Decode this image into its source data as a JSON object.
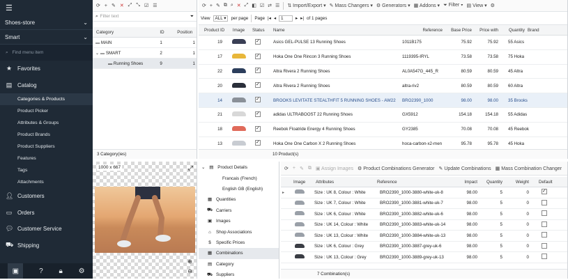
{
  "sidebar": {
    "store": "Shoes-store",
    "mode": "Smart",
    "search_placeholder": "Find menu item",
    "items": [
      {
        "label": "Favorites",
        "icon": "star-icon"
      },
      {
        "label": "Catalog",
        "icon": "catalog-icon"
      }
    ],
    "catalog_sub": [
      "Categories & Products",
      "Product Picker",
      "Attributes & Groups",
      "Product Brands",
      "Product Suppliers",
      "Features",
      "Tags",
      "Attachments"
    ],
    "items2": [
      {
        "label": "Customers",
        "icon": "customers-icon"
      },
      {
        "label": "Orders",
        "icon": "orders-icon"
      },
      {
        "label": "Customer Service",
        "icon": "customer-service-icon"
      },
      {
        "label": "Shipping",
        "icon": "shipping-icon"
      }
    ]
  },
  "categories": {
    "filter_placeholder": "Filter text",
    "headers": [
      "Category",
      "ID",
      "Position"
    ],
    "rows": [
      {
        "name": "MAIN",
        "id": "1",
        "pos": "1"
      },
      {
        "name": "SMART",
        "id": "2",
        "pos": "1"
      },
      {
        "name": "Running Shoes",
        "id": "9",
        "pos": "1"
      }
    ],
    "footer": "3 Category(ies)"
  },
  "image": {
    "size": "1000 x 667"
  },
  "products": {
    "toolbar": {
      "import_export": "Import/Export",
      "mass_changers": "Mass Changers",
      "generators": "Generators",
      "addons": "Addons",
      "filter": "Filter",
      "view": "View"
    },
    "paging": {
      "view": "View",
      "all": "ALL",
      "per_page": "per page",
      "page": "Page",
      "page_num": "1",
      "of_pages": "of 1 pages"
    },
    "headers": [
      "Product ID",
      "Image",
      "Status",
      "Name",
      "Reference",
      "Base Price",
      "Price with",
      "Quantity",
      "Brand"
    ],
    "rows": [
      {
        "id": "19",
        "name": "Asics GEL-PULSE 13 Running Shoes",
        "ref": "1011B175",
        "base": "75.92",
        "price": "75.92",
        "qty": "55",
        "brand": "Asics",
        "color": "#3a3f55"
      },
      {
        "id": "17",
        "name": "Hoka One One Rincon 3 Running Shoes",
        "ref": "1119395-IRYL",
        "base": "73.58",
        "price": "73.58",
        "qty": "75",
        "brand": "Hoka",
        "color": "#e8b73a"
      },
      {
        "id": "22",
        "name": "Altra Rivera 2 Running Shoes",
        "ref": "AL0A547G_445_R",
        "base": "80.59",
        "price": "80.59",
        "qty": "45",
        "brand": "Altra",
        "color": "#2c3e5c"
      },
      {
        "id": "20",
        "name": "Altra Rivera 2 Running Shoes",
        "ref": "altra-riv2",
        "base": "80.59",
        "price": "80.59",
        "qty": "60",
        "brand": "Altra",
        "color": "#2a2f3a"
      },
      {
        "id": "14",
        "name": "BROOKS LEVITATE STEALTHFIT 5 RUNNING SHOES - AW22",
        "ref": "BRO2390_1000",
        "base": "98.00",
        "price": "98.00",
        "qty": "35",
        "brand": "Brooks",
        "color": "#8a9098"
      },
      {
        "id": "21",
        "name": "adidas ULTRABOOST 22 Running Shoes",
        "ref": "GX5912",
        "base": "154.18",
        "price": "154.18",
        "qty": "55",
        "brand": "Adidas",
        "color": "#d8d8d8"
      },
      {
        "id": "18",
        "name": "Reebok Floatride Energy 4 Running Shoes",
        "ref": "GY2385",
        "base": "70.08",
        "price": "70.08",
        "qty": "45",
        "brand": "Reebok",
        "color": "#e06a5a"
      },
      {
        "id": "13",
        "name": "Hoka One One Carbon X 2 Running Shoes",
        "ref": "hoca-carbon-x2-men",
        "base": "95.78",
        "price": "95.78",
        "qty": "45",
        "brand": "Hoka",
        "color": "#c8ccd2"
      }
    ],
    "footer": "10 Product(s)"
  },
  "details": {
    "items": [
      {
        "label": "Product Details",
        "icon": "details-icon",
        "top": true
      },
      {
        "label": "Francais (French)",
        "sub": true
      },
      {
        "label": "English GB (English)",
        "sub": true
      },
      {
        "label": "Quantities",
        "icon": "quantities-icon"
      },
      {
        "label": "Carriers",
        "icon": "carriers-icon"
      },
      {
        "label": "Images",
        "icon": "images-icon"
      },
      {
        "label": "Shop Associations",
        "icon": "shop-icon"
      },
      {
        "label": "Specific Prices",
        "icon": "prices-icon"
      },
      {
        "label": "Combinations",
        "icon": "combinations-icon",
        "active": true
      },
      {
        "label": "Category",
        "icon": "category-icon"
      },
      {
        "label": "Suppliers",
        "icon": "suppliers-icon"
      }
    ]
  },
  "combinations": {
    "toolbar": {
      "assign_images": "Assign Images",
      "generator": "Product Combinations Generator",
      "update": "Update Combinations",
      "mass": "Mass Combination Changer"
    },
    "headers": [
      "Image",
      "Attributes",
      "Reference",
      "Impact",
      "Quantity",
      "Weight",
      "Default"
    ],
    "rows": [
      {
        "attr": "Size : UK 8, Colour : White",
        "ref": "BRO2390_1000-3880-white-uk-8",
        "impact": "98.00",
        "qty": "5",
        "weight": "0",
        "def": true,
        "color": "#9aa0a8"
      },
      {
        "attr": "Size : UK 7, Colour : White",
        "ref": "BRO2390_1000-3881-white-uk-7",
        "impact": "98.00",
        "qty": "5",
        "weight": "0",
        "def": false,
        "color": "#9aa0a8"
      },
      {
        "attr": "Size : UK 6, Colour : White",
        "ref": "BRO2390_1000-3882-white-uk-6",
        "impact": "98.00",
        "qty": "5",
        "weight": "0",
        "def": false,
        "color": "#9aa0a8"
      },
      {
        "attr": "Size : UK 14, Colour : White",
        "ref": "BRO2390_1000-3883-white-uk-14",
        "impact": "98.00",
        "qty": "5",
        "weight": "0",
        "def": false,
        "color": "#9aa0a8"
      },
      {
        "attr": "Size : UK 13, Colour : White",
        "ref": "BRO2390_1000-3884-white-uk-13",
        "impact": "98.00",
        "qty": "5",
        "weight": "0",
        "def": false,
        "color": "#9aa0a8"
      },
      {
        "attr": "Size : UK 6, Colour : Grey",
        "ref": "BRO2390_1000-3887-grey-uk-6",
        "impact": "98.00",
        "qty": "5",
        "weight": "0",
        "def": false,
        "color": "#3a3d44"
      },
      {
        "attr": "Size : UK 13, Colour : Grey",
        "ref": "BRO2390_1000-3889-grey-uk-13",
        "impact": "98.00",
        "qty": "5",
        "weight": "0",
        "def": false,
        "color": "#3a3d44"
      }
    ],
    "footer": "7 Combination(s)"
  }
}
